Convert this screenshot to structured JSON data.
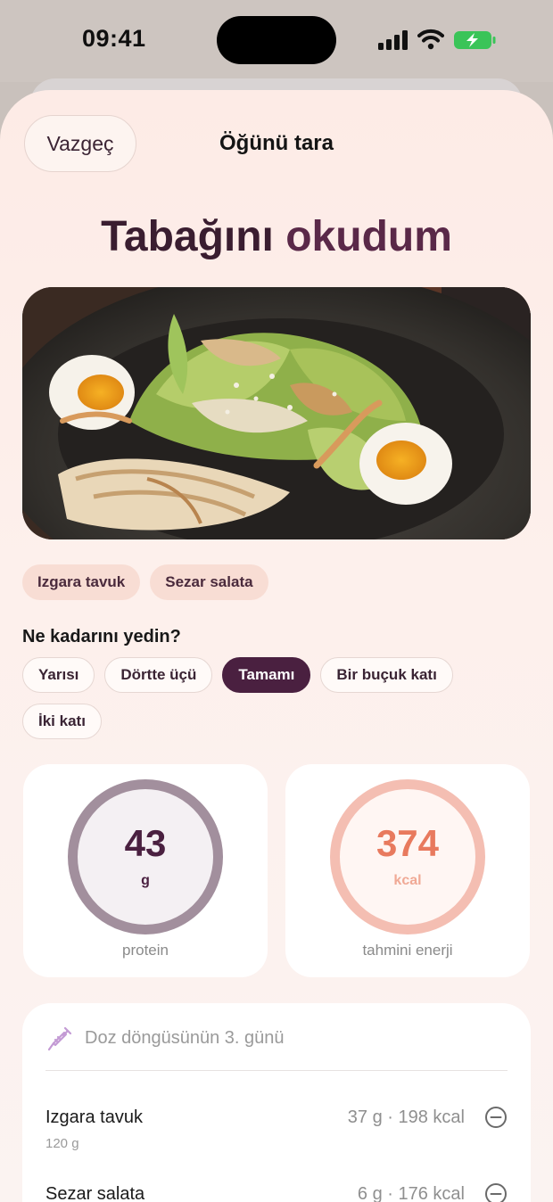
{
  "status_bar": {
    "time": "09:41"
  },
  "header": {
    "cancel_label": "Vazgeç",
    "title": "Öğünü tara"
  },
  "headline": {
    "part1": "Tabağını",
    "part2": "okudum"
  },
  "meal_photo": {
    "icon": "meal-photo-caesar-salad"
  },
  "detected_foods": [
    "Izgara tavuk",
    "Sezar salata"
  ],
  "portion": {
    "question": "Ne kadarını yedin?",
    "options": [
      "Yarısı",
      "Dörtte üçü",
      "Tamamı",
      "Bir buçuk katı",
      "İki katı"
    ],
    "selected": "Tamamı"
  },
  "stats": {
    "protein": {
      "value": "43",
      "unit": "g",
      "label": "protein",
      "color": "#a28f9d"
    },
    "energy": {
      "value": "374",
      "unit": "kcal",
      "label": "tahmini enerji",
      "color": "#e87a5e"
    }
  },
  "details": {
    "dose_icon": "syringe-icon",
    "dose_text": "Doz döngüsünün 3. günü",
    "items": [
      {
        "name": "Izgara tavuk",
        "grams": "120 g",
        "stats": "37 g · 198 kcal"
      },
      {
        "name": "Sezar salata",
        "stats": "6 g · 176 kcal"
      }
    ]
  },
  "colors": {
    "accent": "#4a2040",
    "energy": "#e87a5e",
    "chip_bg": "#f8ddd4"
  }
}
